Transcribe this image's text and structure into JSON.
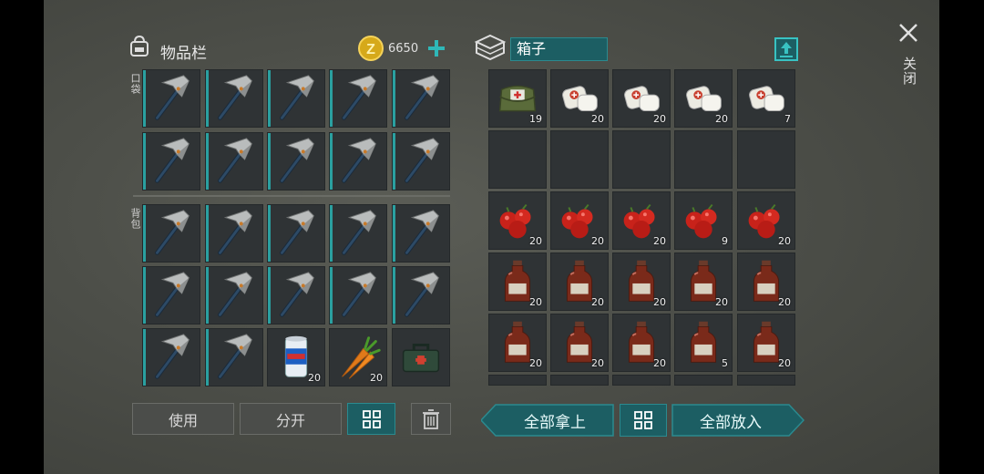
{
  "inventory": {
    "title": "物品栏",
    "coins": "6650",
    "pocket_label": "口袋",
    "backpack_label": "背包",
    "use_label": "使用",
    "split_label": "分开",
    "items_extra": [
      {
        "icon": "soda-can-icon",
        "count": "20"
      },
      {
        "icon": "carrot-icon",
        "count": "20"
      },
      {
        "icon": "toolbox-icon",
        "count": ""
      }
    ]
  },
  "container": {
    "name": "箱子",
    "take_all_label": "全部拿上",
    "put_all_label": "全部放入",
    "rows": [
      [
        {
          "icon": "medkit-bag-icon",
          "count": "19"
        },
        {
          "icon": "bandage-icon",
          "count": "20"
        },
        {
          "icon": "bandage-icon",
          "count": "20"
        },
        {
          "icon": "bandage-icon",
          "count": "20"
        },
        {
          "icon": "bandage-icon",
          "count": "7"
        }
      ],
      [
        {
          "icon": "",
          "count": ""
        },
        {
          "icon": "",
          "count": ""
        },
        {
          "icon": "",
          "count": ""
        },
        {
          "icon": "",
          "count": ""
        },
        {
          "icon": "",
          "count": ""
        }
      ],
      [
        {
          "icon": "berries-icon",
          "count": "20"
        },
        {
          "icon": "berries-icon",
          "count": "20"
        },
        {
          "icon": "berries-icon",
          "count": "20"
        },
        {
          "icon": "berries-icon",
          "count": "9"
        },
        {
          "icon": "berries-icon",
          "count": "20"
        }
      ],
      [
        {
          "icon": "potion-bottle-icon",
          "count": "20"
        },
        {
          "icon": "potion-bottle-icon",
          "count": "20"
        },
        {
          "icon": "potion-bottle-icon",
          "count": "20"
        },
        {
          "icon": "potion-bottle-icon",
          "count": "20"
        },
        {
          "icon": "potion-bottle-icon",
          "count": "20"
        }
      ],
      [
        {
          "icon": "potion-bottle-icon",
          "count": "20"
        },
        {
          "icon": "potion-bottle-icon",
          "count": "20"
        },
        {
          "icon": "potion-bottle-icon",
          "count": "20"
        },
        {
          "icon": "potion-bottle-icon",
          "count": "5"
        },
        {
          "icon": "potion-bottle-icon",
          "count": "20"
        }
      ]
    ]
  },
  "close_label": "关闭",
  "colors": {
    "accent": "#2aa0a0",
    "button_teal": "#1c5e63",
    "slot_bg": "#2f3335"
  }
}
